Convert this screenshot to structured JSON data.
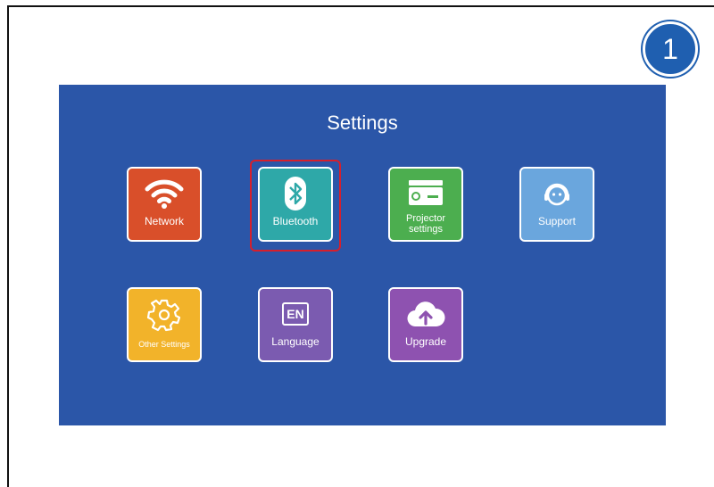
{
  "step_badge": "1",
  "screen": {
    "title": "Settings",
    "selected": "Bluetooth",
    "tiles": [
      {
        "label": "Network",
        "icon": "wifi-icon",
        "color": "#d94f2a"
      },
      {
        "label": "Bluetooth",
        "icon": "bluetooth-icon",
        "color": "#2ea8a8"
      },
      {
        "label": "Projector\nsettings",
        "icon": "projector-icon",
        "color": "#4cae4f"
      },
      {
        "label": "Support",
        "icon": "support-headset-icon",
        "color": "#6aa6dd"
      },
      {
        "label": "Other Settings",
        "icon": "gear-icon",
        "color": "#f2b32a"
      },
      {
        "label": "Language",
        "icon": "language-en-icon",
        "icon_text": "EN",
        "color": "#7b5bb0"
      },
      {
        "label": "Upgrade",
        "icon": "cloud-upload-icon",
        "color": "#8e52b0"
      }
    ]
  },
  "colors": {
    "background": "#2b56a8",
    "highlight": "#d61f2c",
    "badge": "#1f5fb0"
  }
}
